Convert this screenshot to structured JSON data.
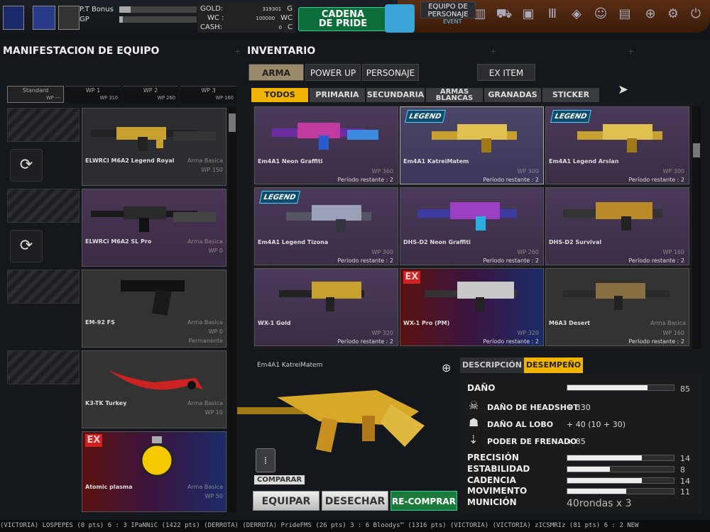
{
  "topbar": {
    "pt_bonus_label": "P.T Bonus",
    "gp_label": "GP",
    "pt_bonus_fill": 0.15,
    "gp_fill": 0.05,
    "gold_label": "GOLD:",
    "gold_value": "319301",
    "gold_unit": "G",
    "wc_label": "WC :",
    "wc_value": "100000",
    "wc_unit": "WC",
    "cash_label": "CASH:",
    "cash_value": "0",
    "cash_unit": "C",
    "pride_label_line1": "CADENA",
    "pride_label_line2": "DE PRIDE",
    "event_label": "EVENT"
  },
  "left": {
    "title": "MANIFESTACION DE EQUIPO",
    "wp_tabs": [
      {
        "label": "Standard",
        "wp": "WP ---"
      },
      {
        "label": "WP 1",
        "wp": "WP 310"
      },
      {
        "label": "WP 2",
        "wp": "WP 260"
      },
      {
        "label": "WP 3",
        "wp": "WP 160"
      }
    ],
    "items": [
      {
        "name": "ELWRCI M6A2 Legend Royal",
        "category": "Arma Basica",
        "wp": "WP 150",
        "extra": ""
      },
      {
        "name": "ELWRCi M6A2 SL Pro",
        "category": "Arma Basica",
        "wp": "WP 0",
        "extra": ""
      },
      {
        "name": "EM-92 FS",
        "category": "Arma Basica",
        "wp": "WP 0",
        "extra": "Permanente"
      },
      {
        "name": "K3-TK Turkey",
        "category": "Arma Basica",
        "wp": "WP 10",
        "extra": ""
      },
      {
        "name": "Atomic plasma",
        "category": "Arma Basica",
        "wp": "WP 50",
        "extra": ""
      }
    ],
    "ex_badge": "EX"
  },
  "inventory": {
    "title": "INVENTARIO",
    "tabs": [
      "ARMA",
      "POWER UP",
      "PERSONAJE",
      "EQUIPO DE PERSONAJE",
      "EX ITEM"
    ],
    "subtabs": [
      "TODOS",
      "PRIMARIA",
      "SECUNDARIA",
      "ARMAS BLANCAS",
      "GRANADAS",
      "STICKER"
    ],
    "legend_badge": "LEGEND",
    "ex_badge": "EX",
    "cards": [
      {
        "name": "Em4A1 Neon Graffiti",
        "wp": "WP 360",
        "remaining": "Período restante : 2"
      },
      {
        "name": "Em4A1 KatreiMatem",
        "wp": "WP 300",
        "remaining": "Período restante : 2"
      },
      {
        "name": "Em4A1 Legend Arslan",
        "wp": "WP 300",
        "remaining": "Período restante : 2"
      },
      {
        "name": "Em4A1 Legend Tizona",
        "wp": "WP 300",
        "remaining": "Período restante : 2"
      },
      {
        "name": "DHS-D2 Neon Graffiti",
        "wp": "WP 260",
        "remaining": "Período restante : 2"
      },
      {
        "name": "DHS-D2 Survival",
        "wp": "WP 160",
        "remaining": "Período restante : 2"
      },
      {
        "name": "WX-1 Gold",
        "wp": "WP 320",
        "remaining": "Período restante : 2"
      },
      {
        "name": "WX-1 Pro (PM)",
        "wp": "WP 320",
        "remaining": "Período restante : 2"
      },
      {
        "name": "M6A3 Desert",
        "wp": "WP 160",
        "remaining": "Período restante : 2",
        "category": "Arma Basica"
      }
    ]
  },
  "detail": {
    "selected_name": "Em4A1 KatreiMatem",
    "tabs": [
      "DESCRIPCIÓN",
      "DESEMPEÑO"
    ],
    "damage_label": "DAÑO",
    "damage_value": "85",
    "damage_fill": 0.75,
    "headshot_label": "DAÑO DE HEADSHOT",
    "headshot_value": "+ 330",
    "wolf_label": "DAÑO AL LOBO",
    "wolf_value": "+ 40 (10 + 30)",
    "stopping_label": "PODER DE FRENADO",
    "stopping_value": "+ 85",
    "stats": [
      {
        "label": "PRECISIÓN",
        "value": "14",
        "fill": 0.7
      },
      {
        "label": "ESTABILIDAD",
        "value": "8",
        "fill": 0.4
      },
      {
        "label": "CADENCIA",
        "value": "14",
        "fill": 0.7
      },
      {
        "label": "MOVIMENTO",
        "value": "11",
        "fill": 0.55
      }
    ],
    "ammo_label": "MUNICIÓN",
    "ammo_value": "40rondas x 3",
    "compare_label": "COMPARAR",
    "equip_label": "EQUIPAR",
    "discard_label": "DESECHAR",
    "rebuy_label": "RE-COMPRAR"
  },
  "ticker": "(VICTORIA) LOSPEPES (0 pts) 6 : 3 IPaNNiC (1422 pts) (DERROTA)      (DERROTA) PrideFMS (26 pts) 3 : 6 Bloodys™ (1316 pts) (VICTORIA)      (VICTORIA) zICSMRIz (81 pts) 6 : 2 NEW",
  "colors": {
    "accent": "#f0b400",
    "arma_tab": "#9b8a6a",
    "rebuy": "#1c7a3a",
    "card_purple": "#4b3a5a"
  }
}
